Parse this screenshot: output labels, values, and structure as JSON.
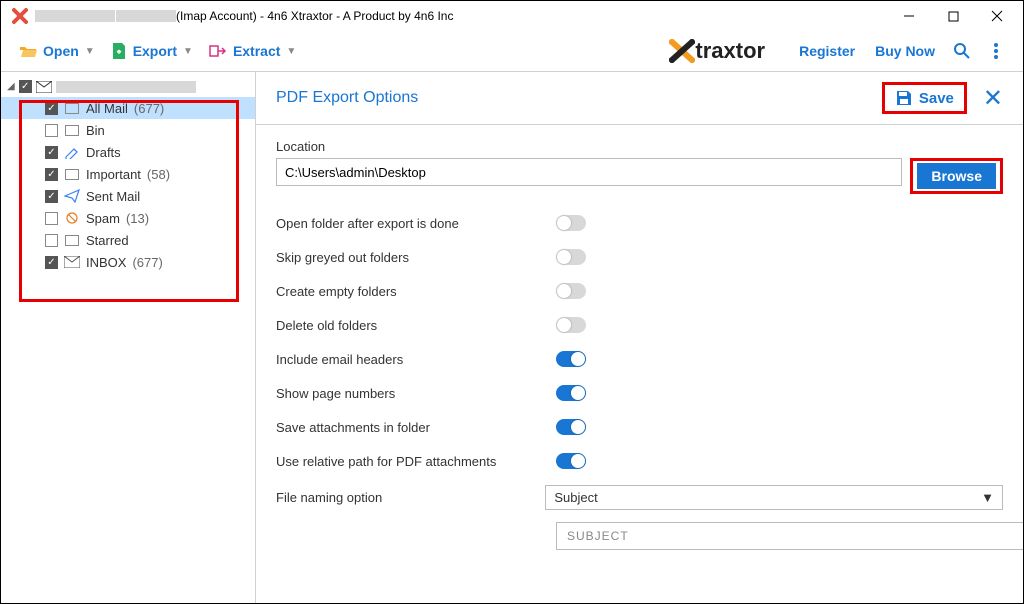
{
  "window": {
    "title_suffix": "(Imap Account) - 4n6 Xtraxtor - A Product by 4n6 Inc"
  },
  "toolbar": {
    "open": "Open",
    "export": "Export",
    "extract": "Extract"
  },
  "logo_text": "traxtor",
  "header_links": {
    "register": "Register",
    "buy": "Buy Now"
  },
  "sidebar": {
    "folders": [
      {
        "checked": true,
        "label": "All Mail",
        "count": "(677)",
        "icon": "box",
        "selected": true
      },
      {
        "checked": false,
        "label": "Bin",
        "count": "",
        "icon": "box"
      },
      {
        "checked": true,
        "label": "Drafts",
        "count": "",
        "icon": "draft"
      },
      {
        "checked": true,
        "label": "Important",
        "count": "(58)",
        "icon": "box"
      },
      {
        "checked": true,
        "label": "Sent Mail",
        "count": "",
        "icon": "sent"
      },
      {
        "checked": false,
        "label": "Spam",
        "count": "(13)",
        "icon": "spam"
      },
      {
        "checked": false,
        "label": "Starred",
        "count": "",
        "icon": "box"
      },
      {
        "checked": true,
        "label": "INBOX",
        "count": "(677)",
        "icon": "inbox"
      }
    ]
  },
  "panel": {
    "title": "PDF Export Options",
    "save": "Save",
    "location_label": "Location",
    "location_value": "C:\\Users\\admin\\Desktop",
    "browse": "Browse",
    "options": [
      {
        "label": "Open folder after export is done",
        "on": false
      },
      {
        "label": "Skip greyed out folders",
        "on": false
      },
      {
        "label": "Create empty folders",
        "on": false
      },
      {
        "label": "Delete old folders",
        "on": false
      },
      {
        "label": "Include email headers",
        "on": true
      },
      {
        "label": "Show page numbers",
        "on": true
      },
      {
        "label": "Save attachments in folder",
        "on": true
      },
      {
        "label": "Use relative path for PDF attachments",
        "on": true
      }
    ],
    "file_naming_label": "File naming option",
    "file_naming_value": "Subject",
    "pattern_preview": "SUBJECT"
  }
}
